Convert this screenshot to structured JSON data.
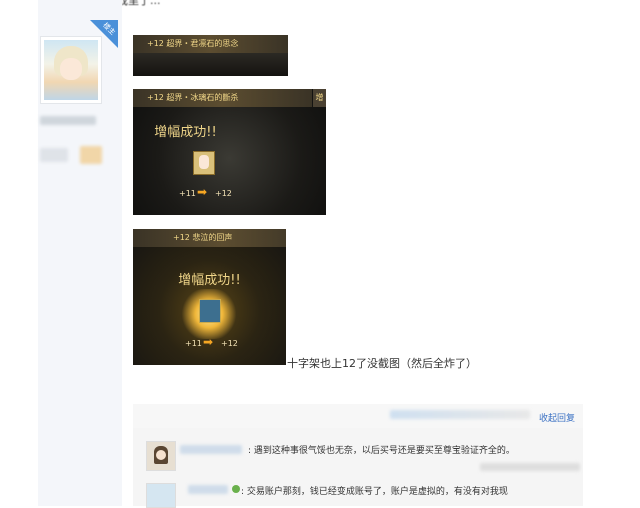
{
  "top_text": "因为我已经在游戏里了...",
  "user": {
    "badge": "楼主",
    "avatar_alt": "avatar"
  },
  "images": [
    {
      "banner": "+12 超界・君凛石的思念"
    },
    {
      "banner": "+12 超界・冰璃石的斷杀",
      "side_tab": "增",
      "result": "增幅成功!!",
      "from": "+11",
      "to": "+12"
    },
    {
      "banner": "+12 悲泣的回声",
      "result": "增幅成功!!",
      "from": "+11",
      "to": "+12"
    }
  ],
  "caption": "十字架也上12了没截图（然后全炸了）",
  "reply_link": "收起回复",
  "comments": [
    {
      "text": ": 遇到这种事很气馁也无奈，以后买号还是要买至尊宝验证齐全的。"
    },
    {
      "text": ": 交易账户那刻，钱已经变成账号了，账户是虚拟的，有没有对我现"
    }
  ],
  "colors": {
    "accent": "#3a70c3",
    "badge": "#4a90d9"
  },
  "icons": [
    "sparkle-icon",
    "arrow-right-icon"
  ]
}
